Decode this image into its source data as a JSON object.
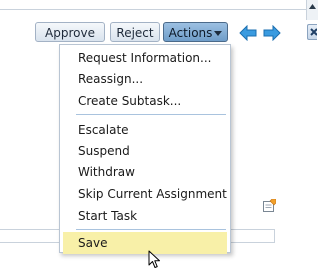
{
  "toolbar": {
    "approve_label": "Approve",
    "reject_label": "Reject",
    "actions_label": "Actions"
  },
  "icons": {
    "back": "arrow-left-icon",
    "forward": "arrow-right-icon",
    "close": "close-icon",
    "note": "note-icon",
    "cursor": "mouse-pointer-icon"
  },
  "actions_menu": {
    "items": [
      "Request Information...",
      "Reassign...",
      "Create Subtask...",
      "Escalate",
      "Suspend",
      "Withdraw",
      "Skip Current Assignment",
      "Start Task",
      "Save"
    ],
    "highlighted_item": "Save"
  },
  "colors": {
    "actions_button": "#7fa9d3",
    "menu_highlight": "#f8f0a8",
    "arrow_blue": "#2f8fd8"
  }
}
